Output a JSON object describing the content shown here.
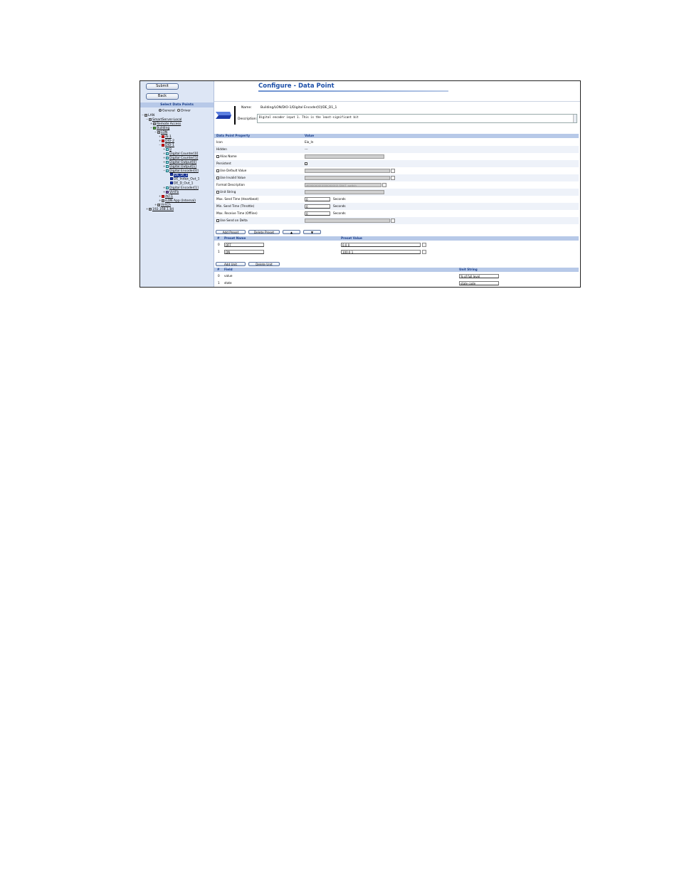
{
  "left_panel": {
    "submit_label": "Submit",
    "back_label": "Back",
    "select_heading": "Select Data Points",
    "radio_general": "General",
    "radio_driver": "Driver",
    "tree": [
      {
        "label": "LAN",
        "depth": 0,
        "toggle": "−",
        "icon": "lan-icon"
      },
      {
        "label": "SmartServer-Local",
        "depth": 1,
        "toggle": "−",
        "icon": "server-icon",
        "link": true
      },
      {
        "label": "Remote Access",
        "depth": 2,
        "toggle": "+",
        "icon": "remote-icon",
        "link": true
      },
      {
        "label": "Building",
        "depth": 2,
        "toggle": "−",
        "icon": "building-icon",
        "link": true
      },
      {
        "label": "LON",
        "depth": 3,
        "toggle": "−",
        "icon": "network-icon",
        "link": true
      },
      {
        "label": "AI-1",
        "depth": 4,
        "toggle": "+",
        "icon": "red-device-icon",
        "link": true
      },
      {
        "label": "DIO-2",
        "depth": 4,
        "toggle": "+",
        "icon": "red-device-icon",
        "link": true
      },
      {
        "label": "DIO-1",
        "depth": 4,
        "toggle": "−",
        "icon": "red-device-icon",
        "link": true
      },
      {
        "label": "0",
        "depth": 5,
        "toggle": "+",
        "icon": "cyan-block-icon",
        "link": true
      },
      {
        "label": "Digital Counter[0]",
        "depth": 5,
        "toggle": "+",
        "icon": "cyan-block-icon",
        "link": true
      },
      {
        "label": "Digital Counter[1]",
        "depth": 5,
        "toggle": "+",
        "icon": "cyan-block-icon",
        "link": true
      },
      {
        "label": "Digital Output[0]",
        "depth": 5,
        "toggle": "+",
        "icon": "cyan-block-icon",
        "link": true
      },
      {
        "label": "Digital Output[1]",
        "depth": 5,
        "toggle": "+",
        "icon": "cyan-block-icon",
        "link": true
      },
      {
        "label": "Digital Encoder[0]",
        "depth": 5,
        "toggle": "−",
        "icon": "cyan-block-icon",
        "link": true
      },
      {
        "label": "DE_DI_1",
        "depth": 6,
        "toggle": "",
        "icon": "datapoint-input-icon",
        "selected": true
      },
      {
        "label": "DE_Index_Out_1",
        "depth": 6,
        "toggle": "",
        "icon": "datapoint-output-icon"
      },
      {
        "label": "DE_D_Out_1",
        "depth": 6,
        "toggle": "",
        "icon": "datapoint-output-icon"
      },
      {
        "label": "Digital Encoder[1]",
        "depth": 5,
        "toggle": "+",
        "icon": "cyan-block-icon",
        "link": true
      },
      {
        "label": "VirtFb",
        "depth": 5,
        "toggle": "+",
        "icon": "virtual-icon",
        "link": true
      },
      {
        "label": "AO-1",
        "depth": 4,
        "toggle": "+",
        "icon": "red-device-icon",
        "link": true
      },
      {
        "label": "iLON App (Internal)",
        "depth": 4,
        "toggle": "+",
        "icon": "app-icon",
        "link": true
      },
      {
        "label": "VirtCh",
        "depth": 3,
        "toggle": "+",
        "icon": "network-icon",
        "link": true
      },
      {
        "label": "192.168.1.84",
        "depth": 1,
        "toggle": "+",
        "icon": "server-icon",
        "link": true
      }
    ]
  },
  "header": {
    "title": "Configure - Data Point"
  },
  "datapoint": {
    "name_label": "Name:",
    "name_value": "Building/LON/DIO-1/Digital Encoder[0]/DE_D1_1",
    "description_label": "Description:",
    "description_value": "Digital encoder input 1. This is the least-significant bit"
  },
  "properties": {
    "col_property": "Data Point Property",
    "col_value": "Value",
    "rows": [
      {
        "label": "Icon",
        "checkbox": false,
        "value": "Eio_In",
        "kind": "text"
      },
      {
        "label": "Hidden",
        "checkbox": false,
        "value": "---",
        "kind": "text"
      },
      {
        "label": "Alias Name",
        "checkbox": true,
        "value": "",
        "kind": "gray"
      },
      {
        "label": "Persistent",
        "checkbox": false,
        "value": "",
        "kind": "checkbox"
      },
      {
        "label": "Use Default Value",
        "checkbox": true,
        "value": "",
        "kind": "gray-btn"
      },
      {
        "label": "Use Invalid Value",
        "checkbox": true,
        "value": "",
        "kind": "gray-btn"
      },
      {
        "label": "Format Description",
        "checkbox": false,
        "value": "#0000000[0]000000[0] SNVT_switch",
        "kind": "gray-btn-short"
      },
      {
        "label": "Unit String",
        "checkbox": true,
        "value": "",
        "kind": "gray"
      },
      {
        "label": "Max. Send Time (Heartbeat)",
        "checkbox": false,
        "value": "0",
        "unit": "Seconds",
        "kind": "input"
      },
      {
        "label": "Min. Send Time (Throttle)",
        "checkbox": false,
        "value": "0",
        "unit": "Seconds",
        "kind": "input"
      },
      {
        "label": "Max. Receive Time (Offline)",
        "checkbox": false,
        "value": "0",
        "unit": "Seconds",
        "kind": "input"
      },
      {
        "label": "Use Send on Delta",
        "checkbox": true,
        "value": "",
        "kind": "gray-btn"
      }
    ]
  },
  "preset_buttons": {
    "add": "Add Preset",
    "delete": "Delete Preset",
    "up": "▲",
    "down": "▼"
  },
  "presets": {
    "col_index": "#",
    "col_name": "Preset Name",
    "col_value": "Preset Value",
    "rows": [
      {
        "index": "0",
        "name": "OFF",
        "value": "0.0 0"
      },
      {
        "index": "1",
        "name": "ON",
        "value": "100.0 1"
      }
    ]
  },
  "unit_buttons": {
    "add": "Add Unit",
    "delete": "Delete Unit"
  },
  "units": {
    "col_index": "#",
    "col_field": "Field",
    "col_unit": "Unit String",
    "rows": [
      {
        "index": "0",
        "field": "value",
        "unit": "% of full level"
      },
      {
        "index": "1",
        "field": "state",
        "unit": "state code"
      }
    ]
  },
  "colors": {
    "title_blue": "#1c4fa8",
    "header_bg": "#b7c9e8",
    "panel_bg": "#dde6f5"
  }
}
